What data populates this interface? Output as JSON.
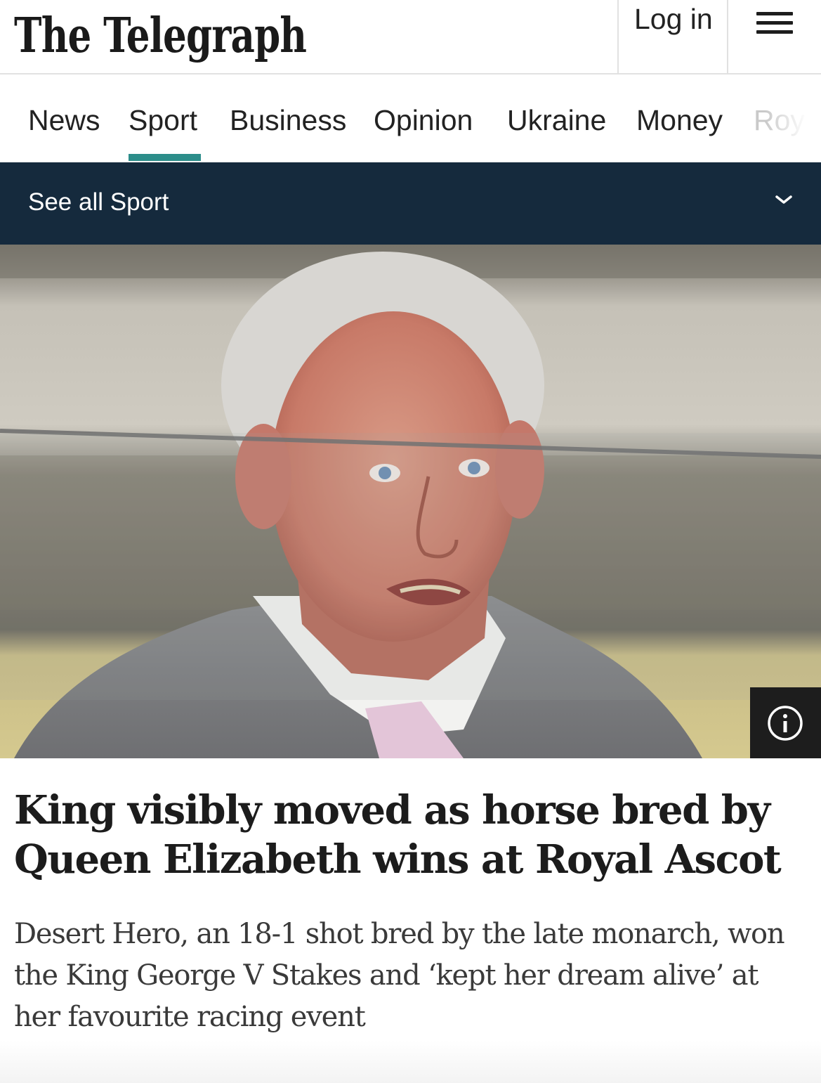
{
  "header": {
    "logo_text": "The Telegraph",
    "login_label": "Log in",
    "menu_icon": "hamburger-menu-icon"
  },
  "nav": {
    "items": [
      {
        "label": "News"
      },
      {
        "label": "Sport",
        "active": true
      },
      {
        "label": "Business"
      },
      {
        "label": "Opinion"
      },
      {
        "label": "Ukraine"
      },
      {
        "label": "Money"
      },
      {
        "label": "Roy"
      }
    ],
    "accent_color": "#2c8d8a"
  },
  "subnav": {
    "label": "See all Sport",
    "icon": "chevron-down-icon",
    "background": "#152a3d"
  },
  "hero": {
    "info_icon": "info-icon"
  },
  "article": {
    "headline": "King visibly moved as horse bred by Queen Elizabeth wins at Royal Ascot",
    "standfirst": "Desert Hero, an 18-1 shot bred by the late monarch, won the King George V Stakes and ‘kept her dream alive’ at her favourite racing event"
  }
}
